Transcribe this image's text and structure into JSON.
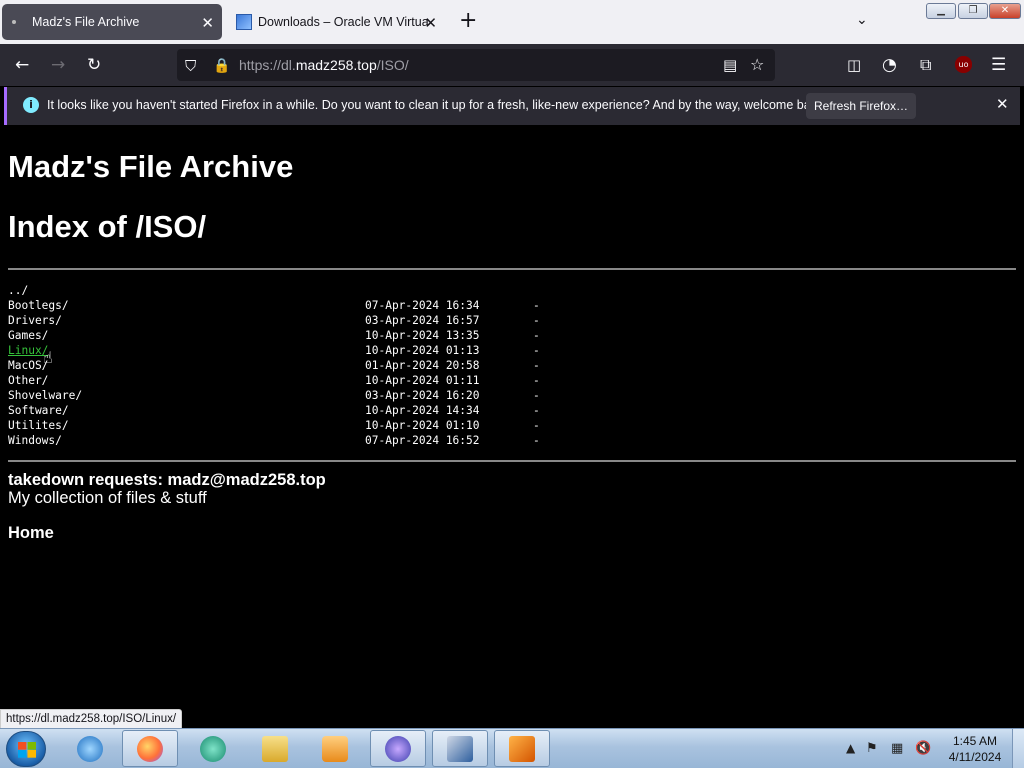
{
  "browser": {
    "tabs": [
      {
        "title": "Madz's File Archive",
        "active": true
      },
      {
        "title": "Downloads – Oracle VM VirtualBox",
        "active": false
      }
    ],
    "url_prefix": "https://dl.",
    "url_host": "madz258.top",
    "url_path": "/ISO/",
    "notification": {
      "text": "It looks like you haven't started Firefox in a while. Do you want to clean it up for a fresh, like-new experience? And by the way, welcome back!",
      "button": "Refresh Firefox…"
    },
    "status_url": "https://dl.madz258.top/ISO/Linux/"
  },
  "page": {
    "site_title": "Madz's File Archive",
    "index_title": "Index of /ISO/",
    "parent_link": "../",
    "entries": [
      {
        "name": "Bootlegs/",
        "date": "07-Apr-2024 16:34",
        "size": "-"
      },
      {
        "name": "Drivers/",
        "date": "03-Apr-2024 16:57",
        "size": "-"
      },
      {
        "name": "Games/",
        "date": "10-Apr-2024 13:35",
        "size": "-"
      },
      {
        "name": "Linux/",
        "date": "10-Apr-2024 01:13",
        "size": "-"
      },
      {
        "name": "MacOS/",
        "date": "01-Apr-2024 20:58",
        "size": "-"
      },
      {
        "name": "Other/",
        "date": "10-Apr-2024 01:11",
        "size": "-"
      },
      {
        "name": "Shovelware/",
        "date": "03-Apr-2024 16:20",
        "size": "-"
      },
      {
        "name": "Software/",
        "date": "10-Apr-2024 14:34",
        "size": "-"
      },
      {
        "name": "Utilites/",
        "date": "10-Apr-2024 01:10",
        "size": "-"
      },
      {
        "name": "Windows/",
        "date": "07-Apr-2024 16:52",
        "size": "-"
      }
    ],
    "takedown": "takedown requests: madz@madz258.top",
    "collection": "My collection of files & stuff",
    "home": "Home"
  },
  "taskbar": {
    "time": "1:45 AM",
    "date": "4/11/2024"
  },
  "colors": {
    "hovered_link": "#36c23b",
    "page_background": "#000000"
  }
}
